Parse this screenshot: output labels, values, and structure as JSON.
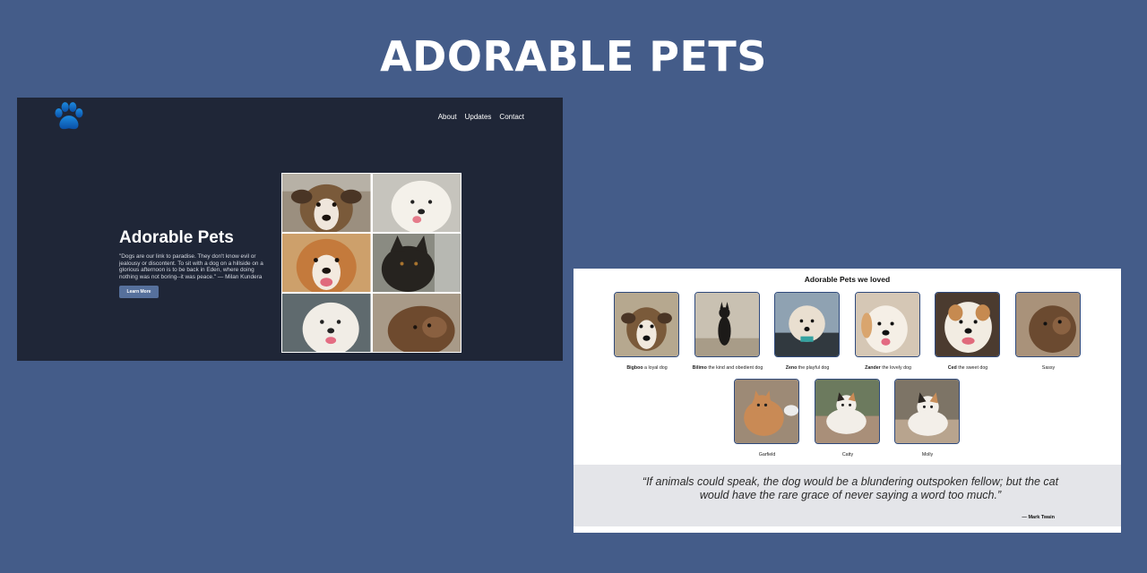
{
  "banner": {
    "title": "ADORABLE PETS"
  },
  "hero": {
    "nav": [
      "About",
      "Updates",
      "Contact"
    ],
    "title": "Adorable Pets",
    "quote": "\"Dogs are our link to paradise. They don't know evil or jealousy or discontent. To sit with a dog on a hillside on a glorious afternoon is to be back in Eden, where doing nothing was not boring--it was peace.\" — Milan Kundera",
    "button": "Learn More",
    "logo_icon": "paw-icon"
  },
  "gallery": {
    "title": "Adorable Pets we loved",
    "pets": [
      {
        "name": "Bigboo",
        "desc": " a loyal dog"
      },
      {
        "name": "Bilimo",
        "desc": " the kind and obedient dog"
      },
      {
        "name": "Zeno",
        "desc": " the playful dog"
      },
      {
        "name": "Zander",
        "desc": " the lovely dog"
      },
      {
        "name": "Ced",
        "desc": " the sweet dog"
      },
      {
        "name": "",
        "desc": "Sassy"
      },
      {
        "name": "",
        "desc": "Garfield"
      },
      {
        "name": "",
        "desc": "Catty"
      },
      {
        "name": "",
        "desc": "Molly"
      }
    ],
    "quote": "“If animals could speak, the dog would be a blundering outspoken fellow; but the cat would have the rare grace of never saying a word too much.”",
    "author": "— Mark Twain"
  },
  "colors": {
    "background": "#445c89",
    "hero_bg": "#1f2637",
    "button": "#56709c",
    "thumb_border": "#2f4a7c",
    "quote_band": "#e4e5e9"
  }
}
